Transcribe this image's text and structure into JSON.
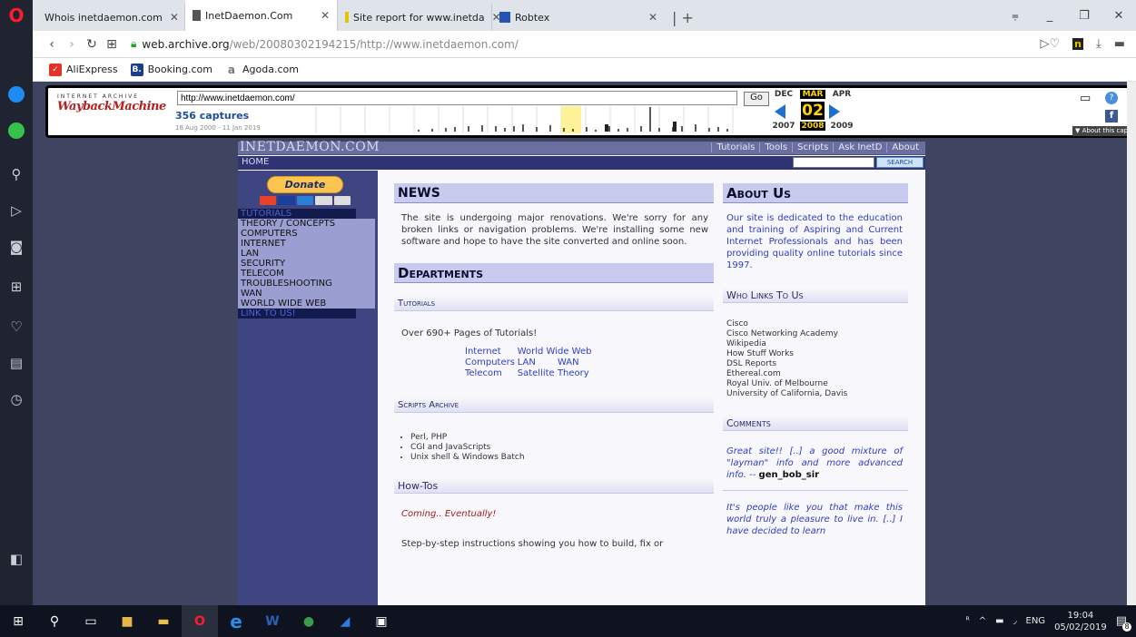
{
  "browser": {
    "tabs": [
      {
        "title": "Whois inetdaemon.com",
        "icon": "opera-globe-icon",
        "active": false
      },
      {
        "title": "InetDaemon.Com",
        "icon": "page-icon",
        "active": true
      },
      {
        "title": "Site report for www.inetda",
        "icon": "netcraft-icon",
        "active": false
      },
      {
        "title": "Robtex",
        "icon": "robtex-icon",
        "active": false
      }
    ],
    "address": {
      "host": "web.archive.org",
      "path": "/web/20080302194215/http://www.inetdaemon.com/"
    },
    "bookmarks": [
      {
        "label": "AliExpress",
        "icon": "aliexpress-icon",
        "color": "#e43225"
      },
      {
        "label": "Booking.com",
        "icon": "booking-icon",
        "color": "#1a3f8a"
      },
      {
        "label": "Agoda.com",
        "icon": "agoda-icon",
        "color": "#888888"
      }
    ]
  },
  "wayback": {
    "logo_top": "INTERNET ARCHIVE",
    "logo_main": "WaybackMachine",
    "url_value": "http://www.inetdaemon.com/",
    "go_label": "Go",
    "captures": "356 captures",
    "range": "18 Aug 2000 - 11 Jan 2019",
    "months": {
      "prev": "DEC",
      "current": "MAR",
      "next": "APR"
    },
    "day": "02",
    "years": {
      "prev": "2007",
      "current": "2008",
      "next": "2009"
    },
    "about": "▼ About this capture"
  },
  "site": {
    "logo": "INETDAEMON.COM",
    "nav": [
      "Tutorials",
      "Tools",
      "Scripts",
      "Ask InetD",
      "About"
    ],
    "crumb": "HOME",
    "search_button": "SEARCH",
    "donate": "Donate",
    "leftnav": {
      "tutorials_header": "TUTORIALS",
      "items": [
        "THEORY / CONCEPTS",
        "COMPUTERS",
        "INTERNET",
        "LAN",
        "SECURITY",
        "TELECOM",
        "TROUBLESHOOTING",
        "WAN",
        "WORLD WIDE WEB"
      ],
      "link_header": "LINK TO US!"
    },
    "news": {
      "title": "NEWS",
      "text": "The site is undergoing major renovations. We're sorry for any broken links or navigation problems. We're installing some new software and hope to have the site converted and online soon."
    },
    "departments": {
      "title": "Departments",
      "tutorials_head": "Tutorials",
      "tutorials_text": "Over 690+ Pages of Tutorials!",
      "tutorial_links": [
        [
          "Internet",
          "World Wide Web"
        ],
        [
          "Computers",
          "LAN",
          "WAN"
        ],
        [
          "Telecom",
          "Satellite",
          "Theory"
        ]
      ],
      "scripts_head": "Scripts Archive",
      "scripts": [
        "Perl, PHP",
        "CGI and JavaScripts",
        "Unix shell & Windows Batch"
      ],
      "howtos_head": "How-Tos",
      "howtos_soon": "Coming.. Eventually!",
      "howtos_text": "Step-by-step instructions showing you how to build, fix or"
    },
    "about": {
      "title": "About Us",
      "text": "Our site is dedicated to the education and training of Aspiring and Current Internet Professionals and has been providing quality online tutorials since 1997."
    },
    "links": {
      "title": "Who Links To Us",
      "items": [
        "Cisco",
        "Cisco Networking Academy",
        "Wikipedia",
        "How Stuff Works",
        "DSL Reports",
        "Ethereal.com",
        "Royal Univ. of Melbourne",
        "University of California, Davis"
      ]
    },
    "comments": {
      "title": "Comments",
      "c1": "Great site!! [..] a good mixture of \"layman\" info and more advanced info. --",
      "c1_author": "gen_bob_sir",
      "c2": "It's people like you that make this world truly a pleasure to live in. [..] I have decided to learn"
    }
  },
  "taskbar": {
    "lang": "ENG",
    "time": "19:04",
    "date": "05/02/2019",
    "notifications": "8"
  }
}
